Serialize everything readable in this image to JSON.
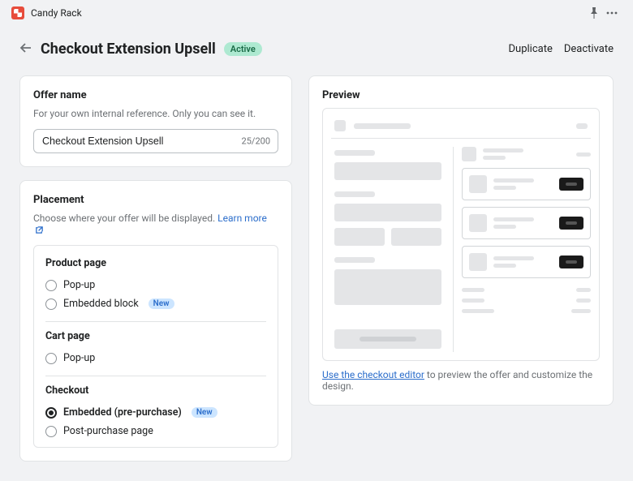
{
  "app": {
    "name": "Candy Rack"
  },
  "header": {
    "title": "Checkout Extension Upsell",
    "status": "Active",
    "duplicate": "Duplicate",
    "deactivate": "Deactivate"
  },
  "offer": {
    "card_title": "Offer name",
    "sub": "For your own internal reference. Only you can see it.",
    "value": "Checkout Extension Upsell",
    "counter": "25/200"
  },
  "placement": {
    "card_title": "Placement",
    "sub_prefix": "Choose where your offer will be displayed. ",
    "learn": "Learn more",
    "groups": {
      "product": {
        "title": "Product page",
        "popup": "Pop-up",
        "embedded": "Embedded block",
        "new": "New"
      },
      "cart": {
        "title": "Cart page",
        "popup": "Pop-up"
      },
      "checkout": {
        "title": "Checkout",
        "embedded": "Embedded (pre-purchase)",
        "new": "New",
        "post": "Post-purchase page"
      }
    }
  },
  "preview": {
    "card_title": "Preview",
    "link": "Use the checkout editor",
    "footer_rest": " to preview the offer and customize the design."
  }
}
